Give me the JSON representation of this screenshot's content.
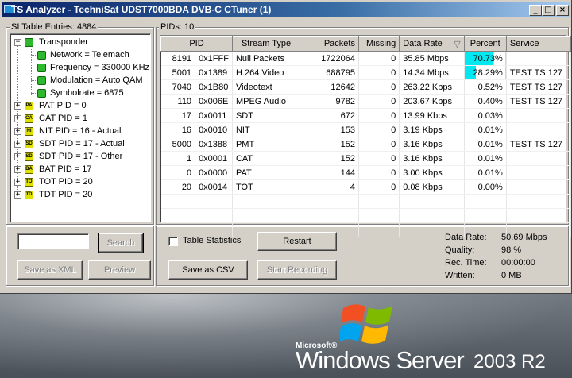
{
  "window": {
    "title": "TS Analyzer - TechniSat UDST7000BDA DVB-C CTuner (1)",
    "min": "_",
    "max": "□",
    "close": "×"
  },
  "si_panel": {
    "label": "SI Table Entries: 4884",
    "tree": {
      "root": "Transponder",
      "params": [
        "Network = Telemach",
        "Frequency = 330000 KHz",
        "Modulation = Auto QAM",
        "Symbolrate = 6875"
      ],
      "tables": [
        {
          "label": "PAT PID = 0",
          "icon": "PA"
        },
        {
          "label": "CAT PID = 1",
          "icon": "CA"
        },
        {
          "label": "NIT PID = 16 - Actual",
          "icon": "NI"
        },
        {
          "label": "SDT PID = 17 - Actual",
          "icon": "SD"
        },
        {
          "label": "SDT PID = 17 - Other",
          "icon": "SD"
        },
        {
          "label": "BAT PID = 17",
          "icon": "BA"
        },
        {
          "label": "TOT PID = 20",
          "icon": "TO"
        },
        {
          "label": "TDT PID = 20",
          "icon": "TD"
        }
      ]
    },
    "search_placeholder": "",
    "search_label": "Search",
    "save_xml_label": "Save as XML",
    "preview_label": "Preview"
  },
  "pid_panel": {
    "label": "PIDs: 10",
    "columns": [
      "PID",
      "Stream Type",
      "Packets",
      "Missing",
      "Data Rate",
      "Percent",
      "Service"
    ],
    "sort_indicator": "▽",
    "rows": [
      {
        "pid_dec": "8191",
        "pid_hex": "0x1FFF",
        "type": "Null Packets",
        "packets": "1722064",
        "missing": "0",
        "rate": "35.85 Mbps",
        "percent": "70.73%",
        "service": ""
      },
      {
        "pid_dec": "5001",
        "pid_hex": "0x1389",
        "type": "H.264 Video",
        "packets": "688795",
        "missing": "0",
        "rate": "14.34 Mbps",
        "percent": "28.29%",
        "service": "TEST TS 127"
      },
      {
        "pid_dec": "7040",
        "pid_hex": "0x1B80",
        "type": "Videotext",
        "packets": "12642",
        "missing": "0",
        "rate": "263.22 Kbps",
        "percent": "0.52%",
        "service": "TEST TS 127"
      },
      {
        "pid_dec": "110",
        "pid_hex": "0x006E",
        "type": "MPEG Audio",
        "packets": "9782",
        "missing": "0",
        "rate": "203.67 Kbps",
        "percent": "0.40%",
        "service": "TEST TS 127"
      },
      {
        "pid_dec": "17",
        "pid_hex": "0x0011",
        "type": "SDT",
        "packets": "672",
        "missing": "0",
        "rate": "13.99 Kbps",
        "percent": "0.03%",
        "service": ""
      },
      {
        "pid_dec": "16",
        "pid_hex": "0x0010",
        "type": "NIT",
        "packets": "153",
        "missing": "0",
        "rate": "3.19 Kbps",
        "percent": "0.01%",
        "service": ""
      },
      {
        "pid_dec": "5000",
        "pid_hex": "0x1388",
        "type": "PMT",
        "packets": "152",
        "missing": "0",
        "rate": "3.16 Kbps",
        "percent": "0.01%",
        "service": "TEST TS 127"
      },
      {
        "pid_dec": "1",
        "pid_hex": "0x0001",
        "type": "CAT",
        "packets": "152",
        "missing": "0",
        "rate": "3.16 Kbps",
        "percent": "0.01%",
        "service": ""
      },
      {
        "pid_dec": "0",
        "pid_hex": "0x0000",
        "type": "PAT",
        "packets": "144",
        "missing": "0",
        "rate": "3.00 Kbps",
        "percent": "0.01%",
        "service": ""
      },
      {
        "pid_dec": "20",
        "pid_hex": "0x0014",
        "type": "TOT",
        "packets": "4",
        "missing": "0",
        "rate": "0.08 Kbps",
        "percent": "0.00%",
        "service": ""
      }
    ],
    "percent_fill": [
      0.7073,
      0.2829
    ],
    "highlight_color": "#00e8f0"
  },
  "controls": {
    "table_stats_label": "Table Statistics",
    "restart_label": "Restart",
    "save_csv_label": "Save as CSV",
    "start_recording_label": "Start Recording"
  },
  "stats": [
    {
      "label": "Data Rate:",
      "value": "50.69 Mbps"
    },
    {
      "label": "Quality:",
      "value": "98 %"
    },
    {
      "label": "Rec. Time:",
      "value": "00:00:00"
    },
    {
      "label": "Written:",
      "value": "0 MB"
    }
  ],
  "desktop": {
    "brand_small": "Microsoft®",
    "brand_main": "Windows Server",
    "brand_version": "2003 R2"
  }
}
